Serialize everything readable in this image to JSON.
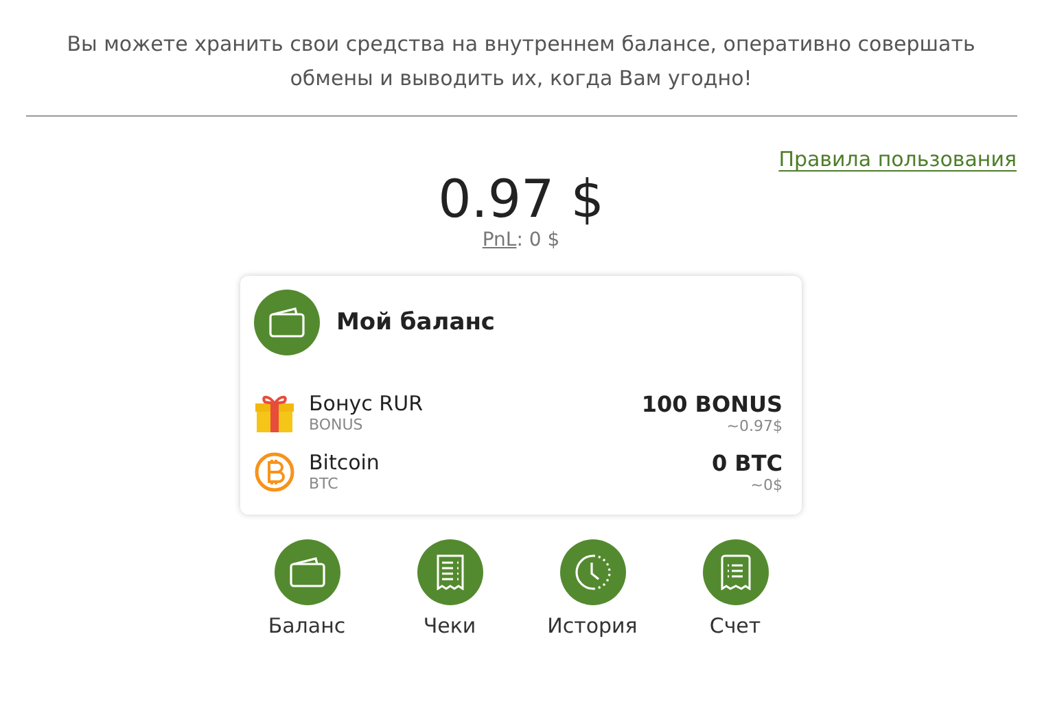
{
  "intro": "Вы можете хранить свои средства на внутреннем балансе, оперативно совершать обмены и выводить их, когда Вам угодно!",
  "rules_link": "Правила пользования",
  "total": "0.97 $",
  "pnl": {
    "label": "PnL",
    "value": ": 0 $"
  },
  "balance_card": {
    "title": "Мой баланс",
    "assets": [
      {
        "kind": "gift",
        "name": "Бонус RUR",
        "code": "BONUS",
        "amount": "100 BONUS",
        "usd": "~0.97$"
      },
      {
        "kind": "bitcoin",
        "name": "Bitcoin",
        "code": "BTC",
        "amount": "0 BTC",
        "usd": "~0$"
      }
    ]
  },
  "actions": [
    {
      "kind": "wallet",
      "label": "Баланс"
    },
    {
      "kind": "receipts",
      "label": "Чеки"
    },
    {
      "kind": "history",
      "label": "История"
    },
    {
      "kind": "invoice",
      "label": "Счет"
    }
  ]
}
